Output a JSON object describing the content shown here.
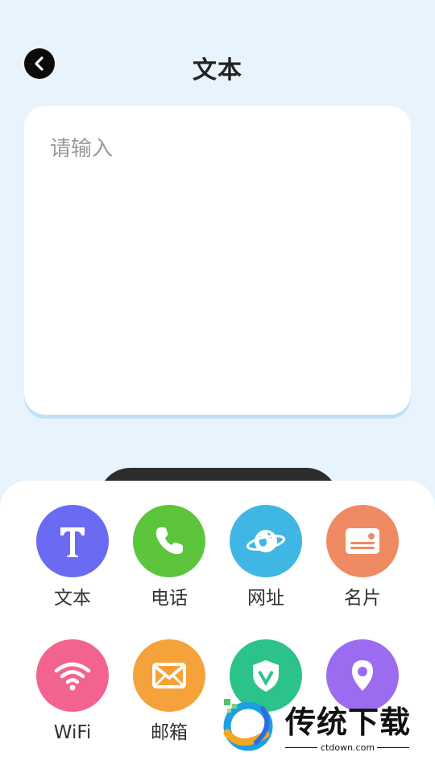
{
  "header": {
    "title": "文本"
  },
  "input": {
    "placeholder": "请输入",
    "value": ""
  },
  "categories": [
    {
      "label": "文本",
      "icon": "text-t-icon",
      "color": "#6a6af2"
    },
    {
      "label": "电话",
      "icon": "phone-icon",
      "color": "#5cc53b"
    },
    {
      "label": "网址",
      "icon": "globe-icon",
      "color": "#3fb6e3"
    },
    {
      "label": "名片",
      "icon": "business-card-icon",
      "color": "#f08a62"
    },
    {
      "label": "WiFi",
      "icon": "wifi-icon",
      "color": "#f2648f"
    },
    {
      "label": "邮箱",
      "icon": "mail-icon",
      "color": "#f6a23a"
    },
    {
      "label": "",
      "icon": "shield-v-icon",
      "color": "#2cc38b"
    },
    {
      "label": "",
      "icon": "location-pin-icon",
      "color": "#9c6cf0"
    }
  ],
  "watermark": {
    "brand": "传统下载",
    "domain": "ctdown.com"
  }
}
